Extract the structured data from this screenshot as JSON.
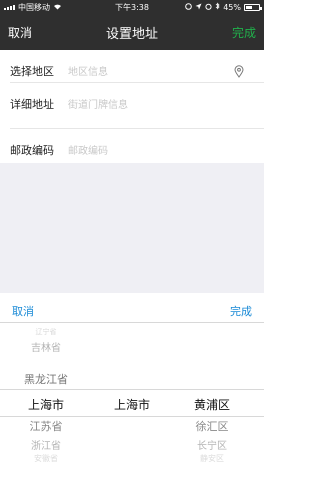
{
  "status_bar": {
    "carrier": "中国移动",
    "time": "下午3:38",
    "battery": "45%"
  },
  "nav": {
    "cancel_label": "取消",
    "title": "设置地址",
    "done_label": "完成"
  },
  "form": {
    "rows": [
      {
        "label": "选择地区",
        "placeholder": "地区信息"
      },
      {
        "label": "详细地址",
        "placeholder": "街道门牌信息"
      },
      {
        "label": "邮政编码",
        "placeholder": "邮政编码"
      }
    ]
  },
  "picker": {
    "cancel_label": "取消",
    "done_label": "完成",
    "provinces": {
      "items": [
        "辽宁省",
        "吉林省",
        "黑龙江省",
        "上海市",
        "江苏省",
        "浙江省",
        "安徽省"
      ],
      "selected": "上海市"
    },
    "cities": {
      "items": [
        "上海市"
      ],
      "selected": "上海市"
    },
    "districts": {
      "items": [
        "黄浦区",
        "徐汇区",
        "长宁区",
        "静安区"
      ],
      "selected": "黄浦区"
    }
  },
  "colors": {
    "nav_bg": "#2f2f2f",
    "accent_green": "#21b14b",
    "link_blue": "#1a8ad6",
    "backdrop": "#efeff4"
  }
}
